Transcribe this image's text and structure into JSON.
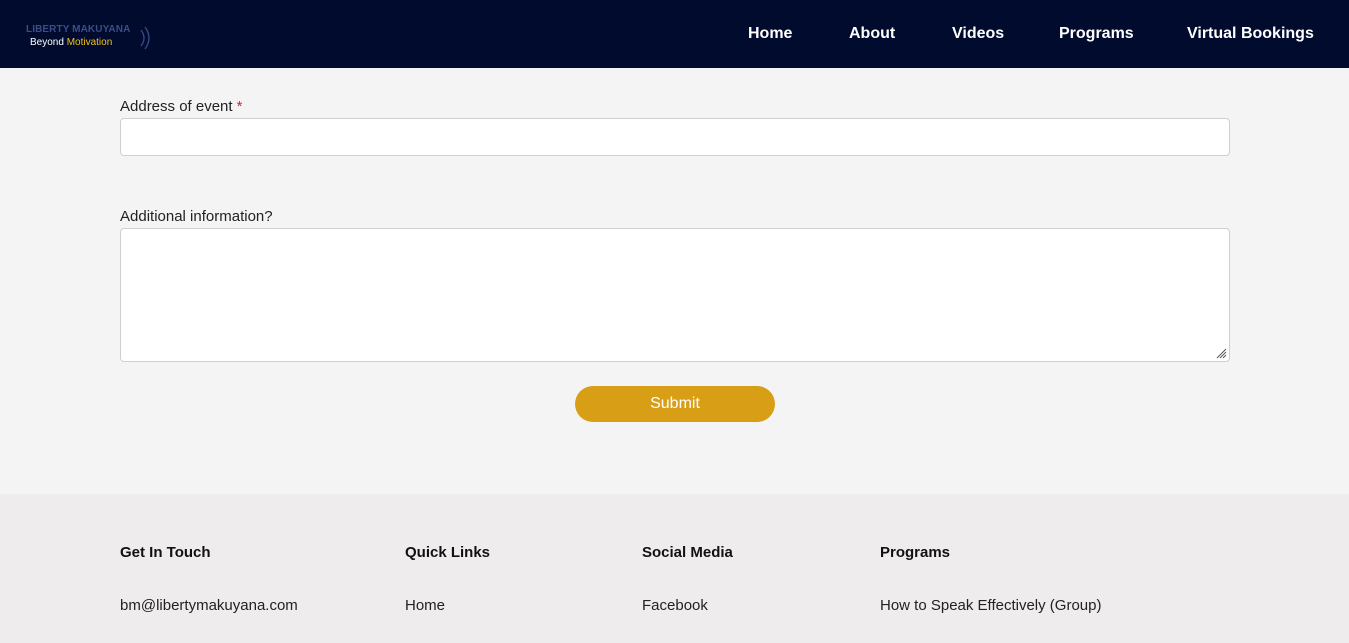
{
  "header": {
    "logo": {
      "line1": "LIBERTY MAKUYANA",
      "line2_prefix": "Beyond ",
      "line2_accent": "Motivation"
    },
    "nav": [
      "Home",
      "About",
      "Videos",
      "Programs",
      "Virtual Bookings"
    ]
  },
  "form": {
    "address_label": "Address of event",
    "required_mark": "*",
    "address_value": "",
    "additional_label": "Additional information?",
    "additional_value": "",
    "submit_label": "Submit"
  },
  "footer": {
    "columns": [
      {
        "heading": "Get In Touch",
        "items": [
          "bm@libertymakuyana.com"
        ]
      },
      {
        "heading": "Quick Links",
        "items": [
          "Home"
        ]
      },
      {
        "heading": "Social Media",
        "items": [
          "Facebook"
        ]
      },
      {
        "heading": "Programs",
        "items": [
          "How to Speak Effectively (Group)"
        ]
      }
    ]
  },
  "colors": {
    "navbar_bg": "#000b2e",
    "accent_gold": "#d89f16",
    "required_red": "#e02020",
    "page_bg": "#f4f4f4",
    "footer_bg": "#eeecec"
  }
}
